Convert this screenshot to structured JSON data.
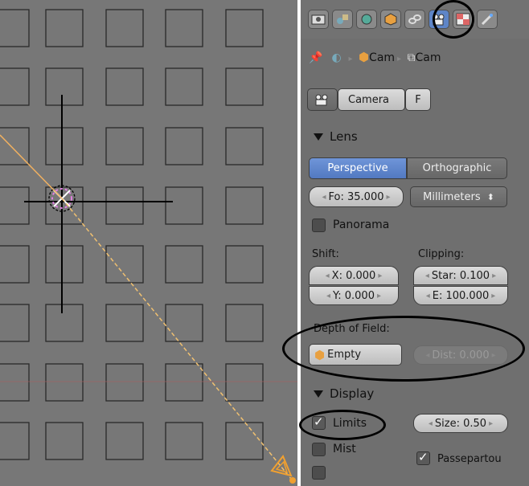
{
  "header": {
    "tabs": [
      "render-icon",
      "scene-icon",
      "world-icon",
      "object-icon",
      "constraints-icon",
      "camera-data-icon",
      "texture-icon",
      "modifiers-icon"
    ],
    "active_tab": "camera-data-icon"
  },
  "breadcrumb": {
    "object": "Cam",
    "data": "Cam"
  },
  "datablock": {
    "name": "Camera",
    "fake_user": "F"
  },
  "lens": {
    "title": "Lens",
    "perspective": "Perspective",
    "orthographic": "Orthographic",
    "focal": "Fo: 35.000",
    "units": "Millimeters",
    "panorama": "Panorama",
    "panorama_checked": false
  },
  "shift": {
    "label": "Shift:",
    "x": "X: 0.000",
    "y": "Y: 0.000"
  },
  "clipping": {
    "label": "Clipping:",
    "start": "Star: 0.100",
    "end": "E: 100.000"
  },
  "dof": {
    "label": "Depth of Field:",
    "object": "Empty",
    "distance": "Dist: 0.000"
  },
  "display": {
    "title": "Display",
    "limits": "Limits",
    "limits_checked": true,
    "size": "Size: 0.50",
    "mist": "Mist",
    "mist_checked": false,
    "passepartout": "Passepartou",
    "passepartout_checked": true
  },
  "colors": {
    "accent": "#5a82c6",
    "panel": "#6f6f6f",
    "viewport": "#777777",
    "dof_line": "#f0c070"
  }
}
